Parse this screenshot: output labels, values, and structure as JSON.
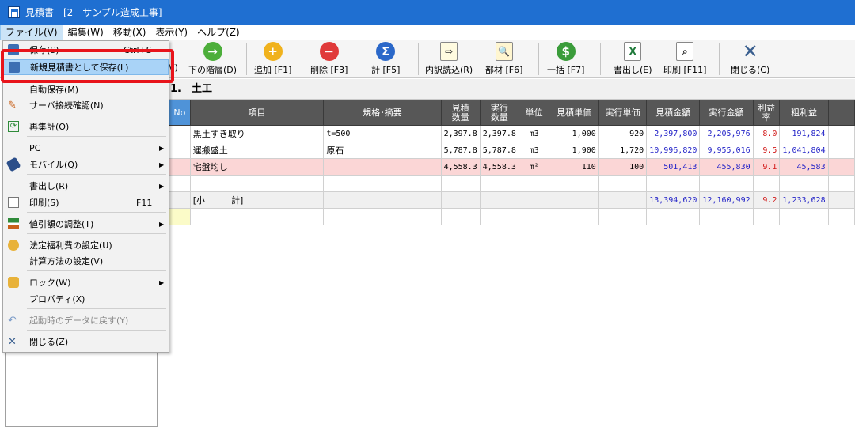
{
  "window": {
    "title": "見積書 - [2　サンプル造成工事]"
  },
  "menubar": [
    "ファイル(V)",
    "編集(W)",
    "移動(X)",
    "表示(Y)",
    "ヘルプ(Z)"
  ],
  "toolbar": {
    "partial_label": "V)",
    "buttons": [
      {
        "label": "下の階層(D)"
      },
      {
        "label": "追加 [F1]"
      },
      {
        "label": "削除 [F3]"
      },
      {
        "label": "計 [F5]"
      },
      {
        "label": "内訳読込(R)"
      },
      {
        "label": "部材 [F6]"
      },
      {
        "label": "一括 [F7]"
      },
      {
        "label": "書出し(E)"
      },
      {
        "label": "印刷 [F11]"
      },
      {
        "label": "閉じる(C)"
      }
    ]
  },
  "section": {
    "title": "1.　土工"
  },
  "table": {
    "headers": [
      "No",
      "項目",
      "規格･摘要",
      "見積\n数量",
      "実行\n数量",
      "単位",
      "見積単価",
      "実行単価",
      "見積金額",
      "実行金額",
      "利益\n率",
      "粗利益"
    ],
    "rows": [
      [
        "黒土すき取り",
        "t=500",
        "2,397.8",
        "2,397.8",
        "m3",
        "1,000",
        "920",
        "2,397,800",
        "2,205,976",
        "8.0",
        "191,824"
      ],
      [
        "運搬盛土",
        "原石",
        "5,787.8",
        "5,787.8",
        "m3",
        "1,900",
        "1,720",
        "10,996,820",
        "9,955,016",
        "9.5",
        "1,041,804"
      ],
      [
        "宅盤均し",
        "",
        "4,558.3",
        "4,558.3",
        "m²",
        "110",
        "100",
        "501,413",
        "455,830",
        "9.1",
        "45,583"
      ]
    ],
    "subtotal": [
      "[小　　　計]",
      "13,394,620",
      "12,160,992",
      "9.2",
      "1,233,628"
    ]
  },
  "file_menu": {
    "items": [
      {
        "label": "保存(S)",
        "shortcut": "Ctrl+S"
      },
      {
        "label": "新規見積書として保存(L)"
      },
      {
        "label": "自動保存(M)"
      },
      {
        "label": "サーバ接続確認(N)"
      },
      {
        "label": "再集計(O)"
      },
      {
        "label": "PC"
      },
      {
        "label": "モバイル(Q)"
      },
      {
        "label": "書出し(R)"
      },
      {
        "label": "印刷(S)",
        "shortcut": "F11"
      },
      {
        "label": "値引額の調整(T)"
      },
      {
        "label": "法定福利費の設定(U)"
      },
      {
        "label": "計算方法の設定(V)"
      },
      {
        "label": "ロック(W)"
      },
      {
        "label": "プロパティ(X)"
      },
      {
        "label": "起動時のデータに戻す(Y)"
      },
      {
        "label": "閉じる(Z)"
      }
    ]
  }
}
